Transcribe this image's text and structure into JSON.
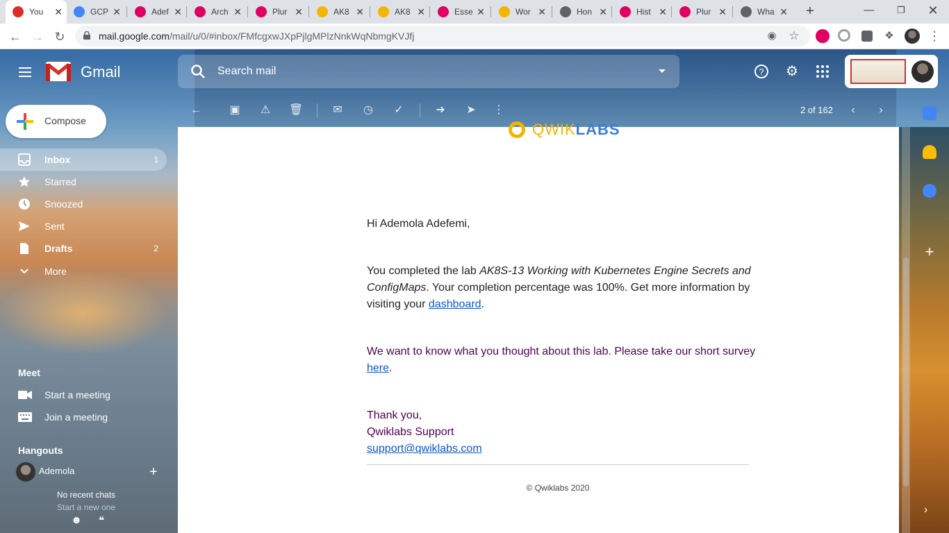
{
  "browser": {
    "tabs": [
      {
        "title": "You",
        "favicon": "gmail-icon",
        "color": "#d93025",
        "active": true
      },
      {
        "title": "GCP",
        "favicon": "google-docs-icon",
        "color": "#4285f4"
      },
      {
        "title": "Adef",
        "favicon": "pluralsight-icon",
        "color": "#e00061"
      },
      {
        "title": "Arch",
        "favicon": "pluralsight-icon",
        "color": "#e00061"
      },
      {
        "title": "Plur",
        "favicon": "pluralsight-icon",
        "color": "#e00061"
      },
      {
        "title": "AK8",
        "favicon": "qwiklabs-icon",
        "color": "#f4b400"
      },
      {
        "title": "AK8",
        "favicon": "qwiklabs-icon",
        "color": "#f4b400"
      },
      {
        "title": "Esse",
        "favicon": "pluralsight-icon",
        "color": "#e00061"
      },
      {
        "title": "Wor",
        "favicon": "qwiklabs-icon",
        "color": "#f4b400"
      },
      {
        "title": "Hon",
        "favicon": "gear-icon",
        "color": "#5f6368"
      },
      {
        "title": "Hist",
        "favicon": "pluralsight-icon",
        "color": "#e00061"
      },
      {
        "title": "Plur",
        "favicon": "pluralsight-icon",
        "color": "#e00061"
      },
      {
        "title": "Wha",
        "favicon": "globe-icon",
        "color": "#5f6368"
      }
    ],
    "url_host": "mail.google.com",
    "url_path": "/mail/u/0/#inbox/FMfcgxwJXpPjlgMPlzNnkWqNbmgKVJfj"
  },
  "gmail": {
    "brand": "Gmail",
    "search_placeholder": "Search mail",
    "compose_label": "Compose",
    "pager": "2 of 162",
    "nav": [
      {
        "label": "Inbox",
        "count": "1",
        "icon": "inbox-icon",
        "selected": true,
        "bold": true
      },
      {
        "label": "Starred",
        "count": "",
        "icon": "star-icon"
      },
      {
        "label": "Snoozed",
        "count": "",
        "icon": "clock-icon"
      },
      {
        "label": "Sent",
        "count": "",
        "icon": "send-icon"
      },
      {
        "label": "Drafts",
        "count": "2",
        "icon": "draft-icon",
        "bold": true
      },
      {
        "label": "More",
        "count": "",
        "icon": "chevron-down-icon"
      }
    ],
    "meet": {
      "title": "Meet",
      "start": "Start a meeting",
      "join": "Join a meeting"
    },
    "hangouts": {
      "title": "Hangouts",
      "user": "Ademola",
      "no_chats": "No recent chats",
      "start_new": "Start a new one"
    }
  },
  "email": {
    "logo_part1": "QWIK",
    "logo_part2": "LABS",
    "greeting": "Hi Ademola Adefemi,",
    "p1_pre": "You completed the lab ",
    "p1_lab": "AK8S-13 Working with Kubernetes Engine Secrets and ConfigMaps",
    "p1_mid": ". Your completion percentage was 100%. Get more information by visiting your ",
    "p1_link": "dashboard",
    "p1_end": ".",
    "p2_pre": "We want to know what you thought about this lab. Please take our short survey ",
    "p2_link": "here",
    "p2_end": ".",
    "thanks": "Thank you,",
    "signature": "Qwiklabs Support",
    "support_email": "support@qwiklabs.com",
    "footer": "© Qwiklabs 2020"
  }
}
